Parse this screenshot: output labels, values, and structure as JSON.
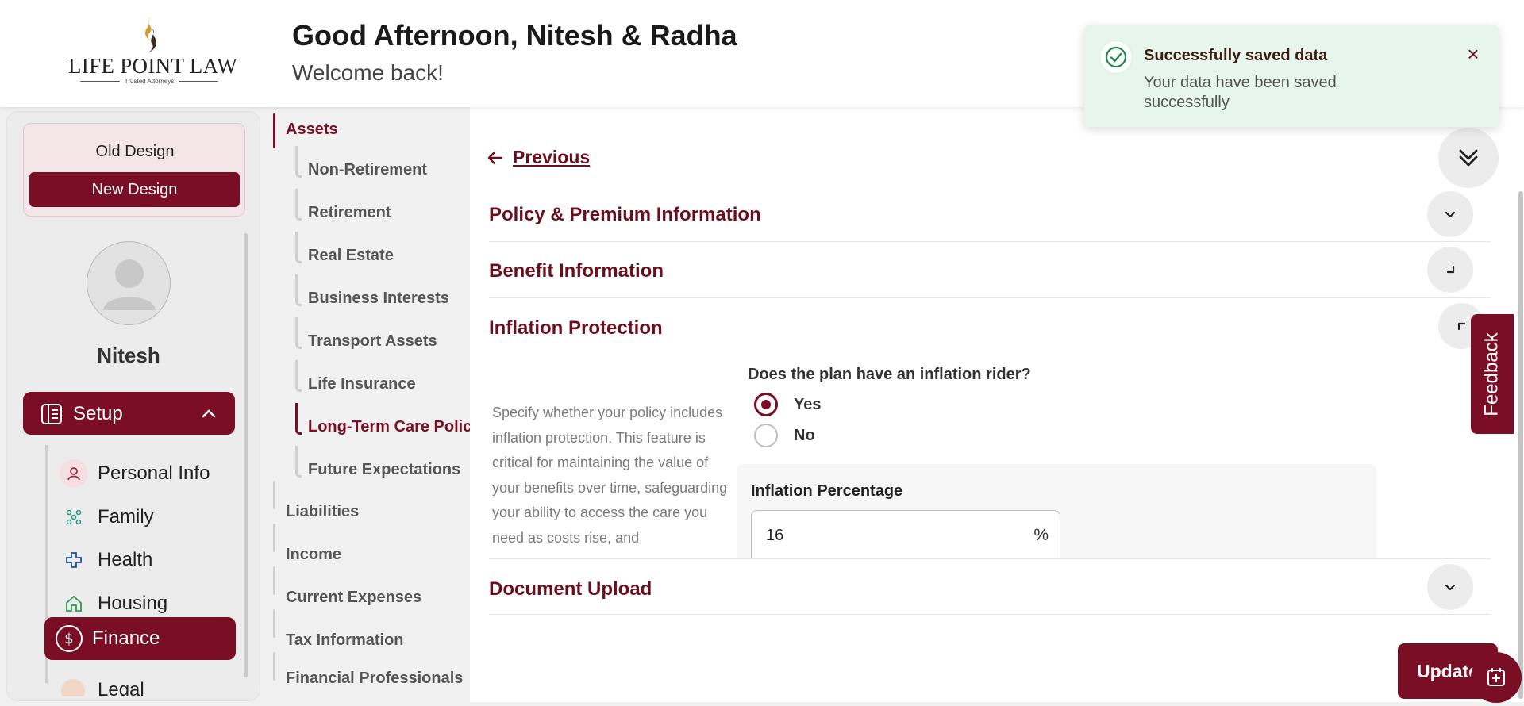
{
  "header": {
    "logo_title": "LIFE POINT LAW",
    "logo_subtitle": "Trusted Attorneys",
    "greeting": "Good Afternoon, Nitesh & Radha",
    "welcome": "Welcome back!"
  },
  "toast": {
    "title": "Successfully saved data",
    "message": "Your data have been saved successfully",
    "close_icon": "×",
    "status_color": "#1e8a4c"
  },
  "sidebar": {
    "old_design": "Old Design",
    "new_design": "New Design",
    "user_name": "Nitesh",
    "setup_label": "Setup",
    "items": [
      {
        "label": "Personal Info",
        "icon": "person-icon"
      },
      {
        "label": "Family",
        "icon": "family-icon"
      },
      {
        "label": "Health",
        "icon": "health-cross-icon"
      },
      {
        "label": "Housing",
        "icon": "house-icon"
      },
      {
        "label": "Finance",
        "icon": "dollar-icon",
        "active": true
      },
      {
        "label": "Legal",
        "icon": "legal-icon"
      }
    ]
  },
  "tree": {
    "assets": "Assets",
    "asset_children": [
      "Non-Retirement",
      "Retirement",
      "Real Estate",
      "Business Interests",
      "Transport Assets",
      "Life Insurance",
      "Long-Term Care Policy",
      "Future Expectations"
    ],
    "selected_child": "Long-Term Care Policy",
    "others": [
      "Liabilities",
      "Income",
      "Current Expenses",
      "Tax Information",
      "Financial Professionals"
    ]
  },
  "main": {
    "previous": "Previous",
    "sections": {
      "policy": "Policy & Premium Information",
      "benefit": "Benefit Information",
      "inflation": "Inflation Protection",
      "document": "Document Upload"
    },
    "inflation": {
      "description": "Specify whether your policy includes inflation protection. This feature is critical for maintaining the value of your benefits over time, safeguarding your ability to access the care you need as costs rise, and",
      "question": "Does the plan have an inflation rider?",
      "options": [
        "Yes",
        "No"
      ],
      "selected": "Yes",
      "percentage_label": "Inflation Percentage",
      "percentage_value": "16",
      "percentage_unit": "%"
    },
    "feedback": "Feedback",
    "update": "Update"
  },
  "colors": {
    "brand": "#7a0e25",
    "toast_bg": "#e6f6ec"
  }
}
